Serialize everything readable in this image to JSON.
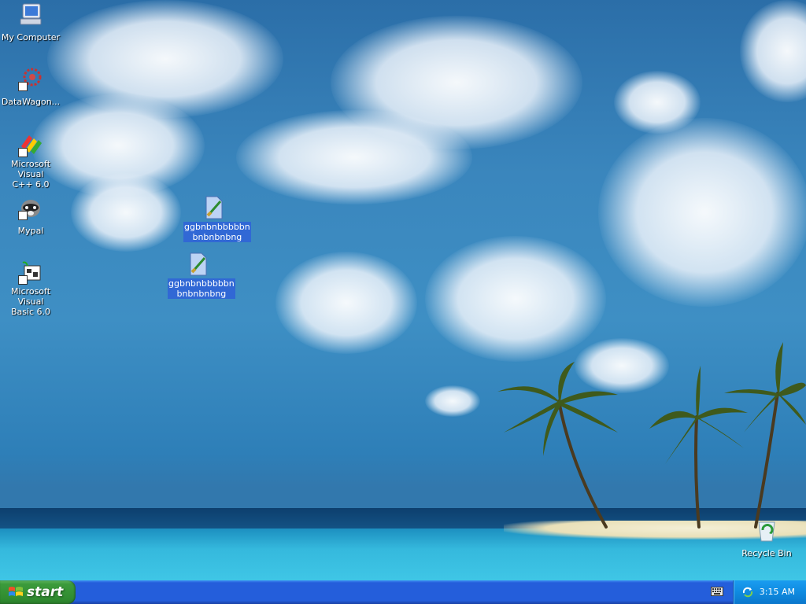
{
  "desktop": {
    "icons": [
      {
        "label_line1": "My Computer",
        "label_line2": ""
      },
      {
        "label_line1": "DataWagon...",
        "label_line2": ""
      },
      {
        "label_line1": "Microsoft Visual",
        "label_line2": "C++ 6.0"
      },
      {
        "label_line1": "Mypal",
        "label_line2": ""
      },
      {
        "label_line1": "Microsoft Visual",
        "label_line2": "Basic 6.0"
      },
      {
        "label_line1": "ggbnbnbbbbbn",
        "label_line2": "bnbnbnbng"
      },
      {
        "label_line1": "ggbnbnbbbbbn",
        "label_line2": "bnbnbnbng"
      },
      {
        "label_line1": "Recycle Bin",
        "label_line2": ""
      }
    ]
  },
  "taskbar": {
    "start_label": "start",
    "clock": "3:15 AM"
  },
  "colors": {
    "taskbar_blue": "#245edb",
    "start_green": "#3c9b3c",
    "tray_blue": "#0f8be0",
    "selection_blue": "#3168d5"
  }
}
